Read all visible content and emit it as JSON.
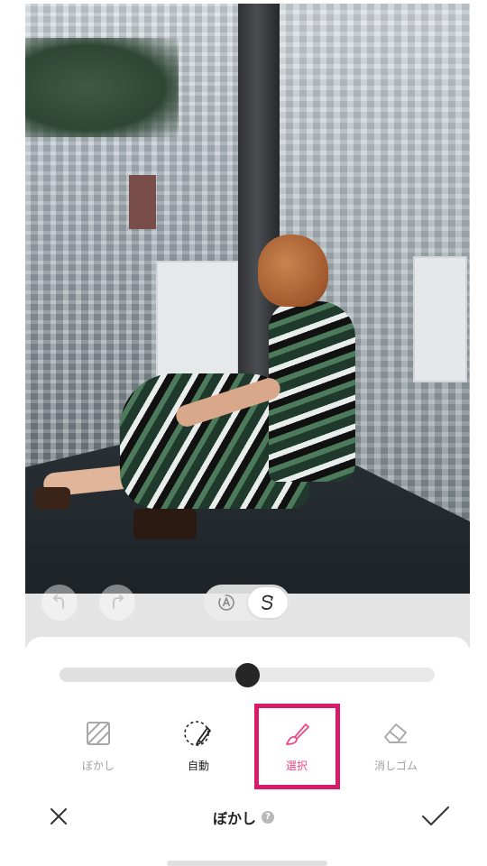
{
  "editor": {
    "blur_strength_fraction": 0.5,
    "active_mode": "manual"
  },
  "tools": [
    {
      "label": "ぼかし",
      "icon": "blur-icon",
      "state": "disabled"
    },
    {
      "label": "自動",
      "icon": "auto-select-icon",
      "state": "normal"
    },
    {
      "label": "選択",
      "icon": "brush-icon",
      "state": "active"
    },
    {
      "label": "消しゴム",
      "icon": "eraser-icon",
      "state": "disabled"
    }
  ],
  "bottom_bar": {
    "title": "ぼかし",
    "help_glyph": "?",
    "close_icon": "close-icon",
    "confirm_icon": "checkmark-icon"
  },
  "colors": {
    "accent": "#e84b86",
    "highlight": "#d81b6a",
    "slider_knob": "#262626"
  }
}
